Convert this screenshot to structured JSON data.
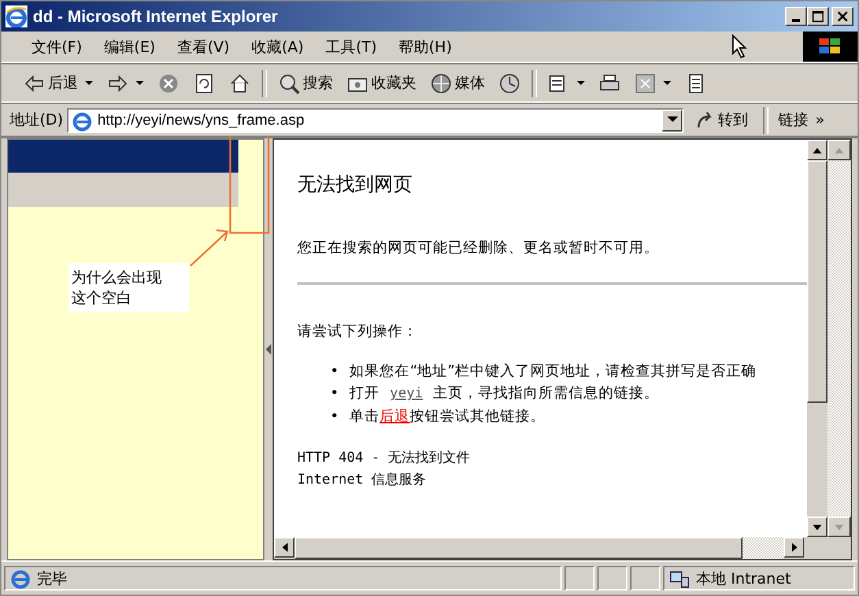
{
  "window": {
    "title": "dd - Microsoft Internet Explorer"
  },
  "menu": [
    {
      "label": "文件(F)"
    },
    {
      "label": "编辑(E)"
    },
    {
      "label": "查看(V)"
    },
    {
      "label": "收藏(A)"
    },
    {
      "label": "工具(T)"
    },
    {
      "label": "帮助(H)"
    }
  ],
  "toolbar": [
    {
      "kind": "back",
      "label": "后退"
    },
    {
      "kind": "forward"
    },
    {
      "kind": "stop"
    },
    {
      "kind": "refresh"
    },
    {
      "kind": "home"
    },
    {
      "kind": "sep"
    },
    {
      "kind": "search",
      "label": "搜索"
    },
    {
      "kind": "favorites",
      "label": "收藏夹"
    },
    {
      "kind": "media",
      "label": "媒体"
    },
    {
      "kind": "history"
    },
    {
      "kind": "sep"
    },
    {
      "kind": "mail"
    },
    {
      "kind": "print"
    },
    {
      "kind": "edit"
    },
    {
      "kind": "note"
    }
  ],
  "address": {
    "label": "地址(D)",
    "value": "http://yeyi/news/yns_frame.asp",
    "go": "转到",
    "links": "链接",
    "more": "»"
  },
  "left_frame": {
    "annotation": [
      "为什么会出现",
      "这个空白"
    ]
  },
  "error_page": {
    "title": "无法找到网页",
    "message": "您正在搜索的网页可能已经删除、更名或暂时不可用。",
    "try": "请尝试下列操作：",
    "bullets": [
      {
        "marker": "•",
        "parts": [
          {
            "kind": "text",
            "text": "如果您在“地址”栏中键入了网页地址，请检查其拼写是否正确"
          }
        ]
      },
      {
        "marker": "•",
        "parts": [
          {
            "kind": "text",
            "text": "打开 "
          },
          {
            "kind": "host",
            "text": "yeyi"
          },
          {
            "kind": "text",
            "text": " 主页，寻找指向所需信息的链接。"
          }
        ]
      },
      {
        "marker": "•",
        "parts": [
          {
            "kind": "text",
            "text": "单击"
          },
          {
            "kind": "link",
            "text": "后退"
          },
          {
            "kind": "text",
            "text": "按钮尝试其他链接。"
          }
        ]
      }
    ],
    "footer": [
      "HTTP 404 - 无法找到文件",
      "Internet 信息服务"
    ]
  },
  "status_bar": {
    "text": "完毕",
    "zone": "本地 Intranet"
  }
}
